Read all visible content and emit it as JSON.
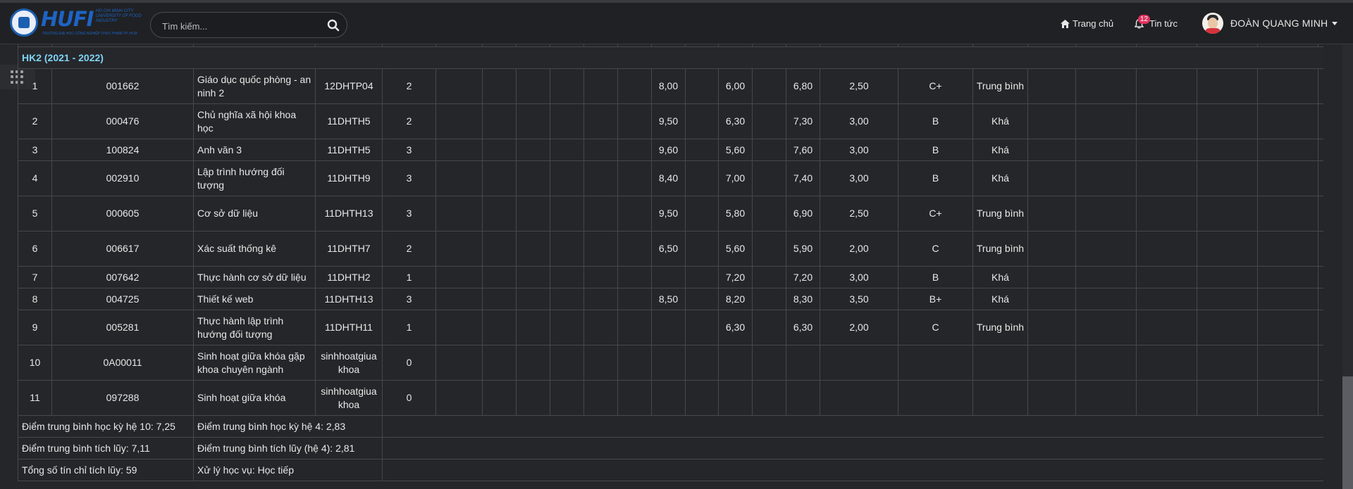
{
  "header": {
    "logo": {
      "main": "HUFI",
      "side": "HO CHI MINH CITY UNIVERSITY OF FOOD INDUSTRY",
      "sub": "TRƯỜNG ĐẠI HỌC CÔNG NGHIỆP THỰC PHẨM TP. HCM"
    },
    "search": {
      "placeholder": "Tìm kiếm..."
    },
    "home_label": "Trang chủ",
    "news_label": "Tin tức",
    "news_badge": "12",
    "user_name": "ĐOÀN QUANG MINH"
  },
  "semester_title": "HK2 (2021 - 2022)",
  "rows": [
    {
      "stt": "1",
      "code": "001662",
      "name": "Giáo dục quốc phòng - an ninh 2",
      "class": "12DHTP04",
      "credits": "2",
      "s1": "8,00",
      "s2": "6,00",
      "total10": "6,80",
      "total4": "2,50",
      "letter": "C+",
      "rank": "Trung bình",
      "tall": true
    },
    {
      "stt": "2",
      "code": "000476",
      "name": "Chủ nghĩa xã hội khoa học",
      "class": "11DHTH5",
      "credits": "2",
      "s1": "9,50",
      "s2": "6,30",
      "total10": "7,30",
      "total4": "3,00",
      "letter": "B",
      "rank": "Khá",
      "tall": true
    },
    {
      "stt": "3",
      "code": "100824",
      "name": "Anh văn 3",
      "class": "11DHTH5",
      "credits": "3",
      "s1": "9,60",
      "s2": "5,60",
      "total10": "7,60",
      "total4": "3,00",
      "letter": "B",
      "rank": "Khá",
      "tall": false
    },
    {
      "stt": "4",
      "code": "002910",
      "name": "Lập trình hướng đối tượng",
      "class": "11DHTH9",
      "credits": "3",
      "s1": "8,40",
      "s2": "7,00",
      "total10": "7,40",
      "total4": "3,00",
      "letter": "B",
      "rank": "Khá",
      "tall": true
    },
    {
      "stt": "5",
      "code": "000605",
      "name": "Cơ sở dữ liệu",
      "class": "11DHTH13",
      "credits": "3",
      "s1": "9,50",
      "s2": "5,80",
      "total10": "6,90",
      "total4": "2,50",
      "letter": "C+",
      "rank": "Trung bình",
      "tall": true
    },
    {
      "stt": "6",
      "code": "006617",
      "name": "Xác suất thống kê",
      "class": "11DHTH7",
      "credits": "2",
      "s1": "6,50",
      "s2": "5,60",
      "total10": "5,90",
      "total4": "2,00",
      "letter": "C",
      "rank": "Trung bình",
      "tall": true
    },
    {
      "stt": "7",
      "code": "007642",
      "name": "Thực hành cơ sở dữ liệu",
      "class": "11DHTH2",
      "credits": "1",
      "s1": "",
      "s2": "7,20",
      "total10": "7,20",
      "total4": "3,00",
      "letter": "B",
      "rank": "Khá",
      "tall": false
    },
    {
      "stt": "8",
      "code": "004725",
      "name": "Thiết kế web",
      "class": "11DHTH13",
      "credits": "3",
      "s1": "8,50",
      "s2": "8,20",
      "total10": "8,30",
      "total4": "3,50",
      "letter": "B+",
      "rank": "Khá",
      "tall": false
    },
    {
      "stt": "9",
      "code": "005281",
      "name": "Thực hành lập trình hướng đối tượng",
      "class": "11DHTH11",
      "credits": "1",
      "s1": "",
      "s2": "6,30",
      "total10": "6,30",
      "total4": "2,00",
      "letter": "C",
      "rank": "Trung bình",
      "tall": true
    },
    {
      "stt": "10",
      "code": "0A00011",
      "name": "Sinh hoạt giữa khóa gặp khoa chuyên ngành",
      "class": "sinhhoatgiua khoa",
      "credits": "0",
      "s1": "",
      "s2": "",
      "total10": "",
      "total4": "",
      "letter": "",
      "rank": "",
      "tall": true
    },
    {
      "stt": "11",
      "code": "097288",
      "name": "Sinh hoạt giữa khóa",
      "class": "sinhhoatgiua khoa",
      "credits": "0",
      "s1": "",
      "s2": "",
      "total10": "",
      "total4": "",
      "letter": "",
      "rank": "",
      "tall": true
    }
  ],
  "summary": {
    "gpa10_sem": "Điểm trung bình học kỳ hệ 10: 7,25",
    "gpa4_sem": "Điểm trung bình học kỳ hệ 4: 2,83",
    "gpa10_cum": "Điểm trung bình tích lũy: 7,11",
    "gpa4_cum": "Điểm trung bình tích lũy (hệ 4): 2,81",
    "credits_total": "Tổng số tín chỉ tích lũy: 59",
    "status": "Xử lý học vụ: Học tiếp"
  },
  "colors": {
    "background": "#252629",
    "semester_title": "#7ed3f5",
    "badge": "#e0315d",
    "logo_blue": "#1d64c4"
  }
}
